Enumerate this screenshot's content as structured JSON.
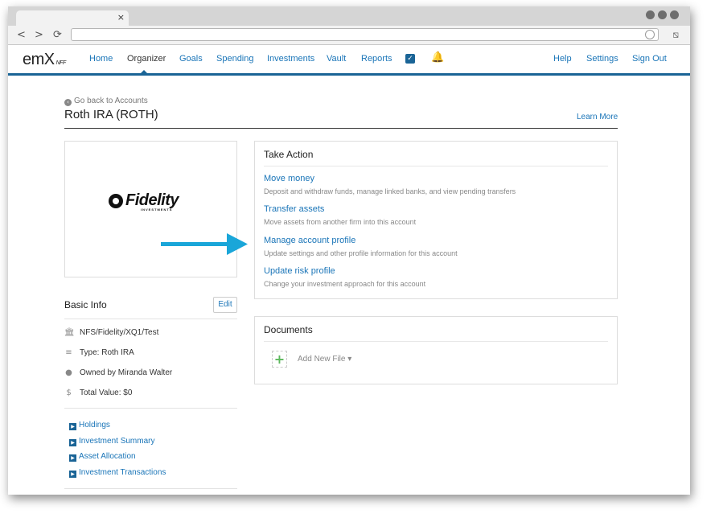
{
  "browser": {
    "tab_close": "×",
    "back_icon": "<",
    "forward_icon": ">",
    "reload_icon": "⟳"
  },
  "nav": {
    "logo": "emX",
    "logo_sub": "NFF",
    "items": [
      {
        "label": "Home"
      },
      {
        "label": "Organizer"
      },
      {
        "label": "Goals"
      },
      {
        "label": "Spending"
      },
      {
        "label": "Investments"
      },
      {
        "label": "Vault"
      },
      {
        "label": "Reports"
      }
    ],
    "right_items": [
      {
        "label": "Help"
      },
      {
        "label": "Settings"
      },
      {
        "label": "Sign Out"
      }
    ],
    "accent_color": "#1a6496"
  },
  "page": {
    "back_label": "Go back to Accounts",
    "title": "Roth IRA (ROTH)",
    "learn_more": "Learn More"
  },
  "institution_logo": {
    "name": "Fidelity",
    "sub": "INVESTMENTS"
  },
  "basic_info": {
    "title": "Basic Info",
    "edit_label": "Edit",
    "rows": [
      {
        "icon": "bank-icon",
        "text": "NFS/Fidelity/XQ1/Test"
      },
      {
        "icon": "list-icon",
        "text": "Type: Roth IRA"
      },
      {
        "icon": "user-icon",
        "text": "Owned by Miranda Walter"
      },
      {
        "icon": "dollar-icon",
        "text": "Total Value: $0"
      }
    ],
    "links": [
      {
        "label": "Holdings"
      },
      {
        "label": "Investment Summary"
      },
      {
        "label": "Asset Allocation"
      },
      {
        "label": "Investment Transactions"
      }
    ]
  },
  "take_action": {
    "title": "Take Action",
    "actions": [
      {
        "label": "Move money",
        "desc": "Deposit and withdraw funds, manage linked banks, and view pending transfers"
      },
      {
        "label": "Transfer assets",
        "desc": "Move assets from another firm into this account"
      },
      {
        "label": "Manage account profile",
        "desc": "Update settings and other profile information for this account"
      },
      {
        "label": "Update risk profile",
        "desc": "Change your investment approach for this account"
      }
    ]
  },
  "documents": {
    "title": "Documents",
    "add_label": "Add New File"
  }
}
